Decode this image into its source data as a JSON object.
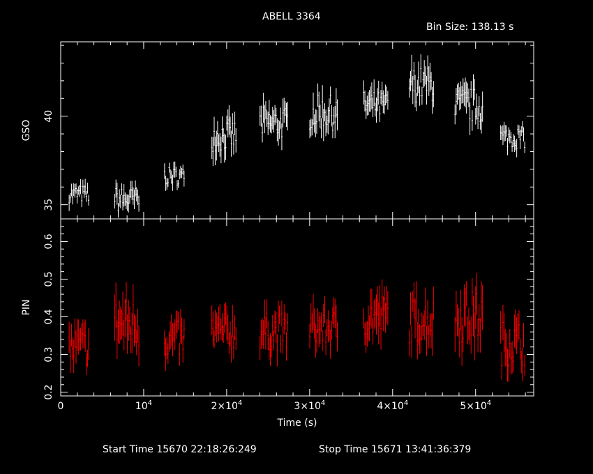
{
  "title": "ABELL 3364",
  "bin_size_label": "Bin Size:  138.13  s",
  "footer": {
    "start_time": "Start Time 15670 22:18:26:249",
    "stop_time": "Stop Time 15671 13:41:36:379"
  },
  "colors": {
    "gso": "#ffffff",
    "pin": "#ff0000",
    "background": "#000000",
    "frame": "#ffffff"
  },
  "chart_data": [
    {
      "type": "scatter",
      "panel": "top",
      "ylabel": "GSO",
      "xlabel": "",
      "xlim": [
        0,
        57000
      ],
      "ylim": [
        34.2,
        44.2
      ],
      "y_ticklabels": [
        "35",
        "40"
      ],
      "series": [
        {
          "color": "#ffffff",
          "segments": [
            {
              "x0": 1000,
              "x1": 3500,
              "level": 35.6,
              "amp": 0.5
            },
            {
              "x0": 6500,
              "x1": 9500,
              "level": 35.3,
              "amp": 0.7
            },
            {
              "x0": 12500,
              "x1": 15000,
              "level": 36.6,
              "amp": 0.5
            },
            {
              "x0": 18200,
              "x1": 21300,
              "level": 38.9,
              "amp": 0.9
            },
            {
              "x0": 24000,
              "x1": 27500,
              "level": 39.6,
              "amp": 0.9
            },
            {
              "x0": 30000,
              "x1": 33500,
              "level": 40.2,
              "amp": 1.0
            },
            {
              "x0": 36500,
              "x1": 39500,
              "level": 40.6,
              "amp": 0.8
            },
            {
              "x0": 42000,
              "x1": 45000,
              "level": 41.8,
              "amp": 1.0
            },
            {
              "x0": 47500,
              "x1": 51000,
              "level": 40.6,
              "amp": 1.0
            },
            {
              "x0": 53000,
              "x1": 56000,
              "level": 38.8,
              "amp": 0.6
            }
          ]
        }
      ]
    },
    {
      "type": "scatter",
      "panel": "bottom",
      "ylabel": "PIN",
      "xlabel": "Time (s)",
      "xlim": [
        0,
        57000
      ],
      "ylim": [
        0.19,
        0.66
      ],
      "y_ticklabels": [
        "0.2",
        "0.3",
        "0.4",
        "0.5",
        "0.6"
      ],
      "x_ticks": [
        0,
        10000,
        20000,
        30000,
        40000,
        50000
      ],
      "x_ticklabels": [
        "0",
        "10",
        "2×10",
        "3×10",
        "4×10",
        "5×10"
      ],
      "x_tick_exponent": "4",
      "series": [
        {
          "color": "#ff0000",
          "segments": [
            {
              "x0": 1000,
              "x1": 3500,
              "level": 0.32,
              "amp": 0.05
            },
            {
              "x0": 6500,
              "x1": 9500,
              "level": 0.38,
              "amp": 0.07
            },
            {
              "x0": 12500,
              "x1": 15000,
              "level": 0.34,
              "amp": 0.05
            },
            {
              "x0": 18200,
              "x1": 21300,
              "level": 0.36,
              "amp": 0.05
            },
            {
              "x0": 24000,
              "x1": 27500,
              "level": 0.36,
              "amp": 0.05
            },
            {
              "x0": 30000,
              "x1": 33500,
              "level": 0.37,
              "amp": 0.05
            },
            {
              "x0": 36500,
              "x1": 39500,
              "level": 0.4,
              "amp": 0.06
            },
            {
              "x0": 42000,
              "x1": 45000,
              "level": 0.39,
              "amp": 0.06
            },
            {
              "x0": 47500,
              "x1": 51000,
              "level": 0.4,
              "amp": 0.07
            },
            {
              "x0": 53000,
              "x1": 56000,
              "level": 0.33,
              "amp": 0.06
            }
          ]
        }
      ]
    }
  ]
}
